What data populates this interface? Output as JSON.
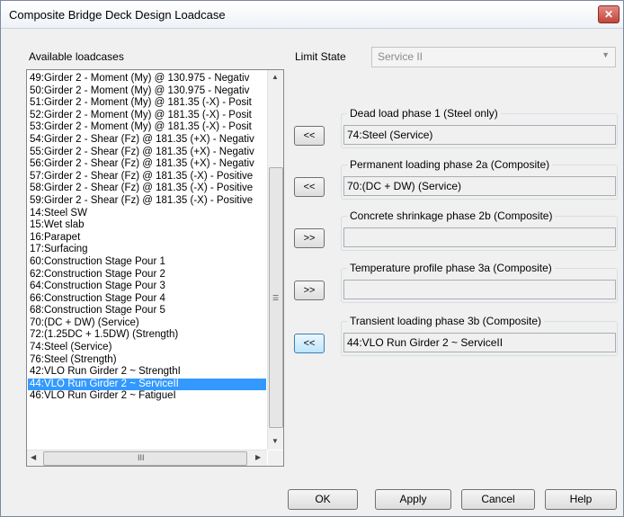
{
  "window": {
    "title": "Composite Bridge Deck Design Loadcase",
    "close_glyph": "✕"
  },
  "available": {
    "label": "Available loadcases",
    "items": [
      "49:Girder 2 - Moment (My) @ 130.975 - Negativ",
      "50:Girder 2 - Moment (My) @ 130.975 - Negativ",
      "51:Girder 2 - Moment (My) @ 181.35 (-X) - Posit",
      "52:Girder 2 - Moment (My) @ 181.35 (-X) - Posit",
      "53:Girder 2 - Moment (My) @ 181.35 (-X) - Posit",
      "54:Girder 2 - Shear (Fz) @ 181.35 (+X) - Negativ",
      "55:Girder 2 - Shear (Fz) @ 181.35 (+X) - Negativ",
      "56:Girder 2 - Shear (Fz) @ 181.35 (+X) - Negativ",
      "57:Girder 2 - Shear (Fz) @ 181.35 (-X) - Positive",
      "58:Girder 2 - Shear (Fz) @ 181.35 (-X) - Positive",
      "59:Girder 2 - Shear (Fz) @ 181.35 (-X) - Positive",
      "14:Steel SW",
      "15:Wet slab",
      "16:Parapet",
      "17:Surfacing",
      "60:Construction Stage Pour 1",
      "62:Construction Stage Pour 2",
      "64:Construction Stage Pour 3",
      "66:Construction Stage Pour 4",
      "68:Construction Stage Pour 5",
      "70:(DC + DW) (Service)",
      "72:(1.25DC + 1.5DW) (Strength)",
      "74:Steel (Service)",
      "76:Steel (Strength)",
      "42:VLO Run Girder 2 ~ StrengthI",
      "44:VLO Run Girder 2 ~ ServiceII",
      "46:VLO Run Girder 2 ~ FatigueI"
    ],
    "selected_index": 25,
    "scroll": {
      "up": "▲",
      "down": "▼",
      "left": "◀",
      "right": "▶",
      "grip_v": "☰",
      "grip_h": "III"
    }
  },
  "limit_state": {
    "label": "Limit State",
    "value": "Service II",
    "arrow": "▼"
  },
  "phases": [
    {
      "title": "Dead load phase 1 (Steel only)",
      "value": "74:Steel (Service)",
      "button": "<<"
    },
    {
      "title": "Permanent loading phase 2a (Composite)",
      "value": "70:(DC + DW) (Service)",
      "button": "<<"
    },
    {
      "title": "Concrete shrinkage phase 2b (Composite)",
      "value": "",
      "button": ">>"
    },
    {
      "title": "Temperature profile phase 3a (Composite)",
      "value": "",
      "button": ">>"
    },
    {
      "title": "Transient loading phase 3b (Composite)",
      "value": "44:VLO Run Girder 2 ~ ServiceII",
      "button": "<<"
    }
  ],
  "buttons": {
    "ok": "OK",
    "apply": "Apply",
    "cancel": "Cancel",
    "help": "Help"
  }
}
